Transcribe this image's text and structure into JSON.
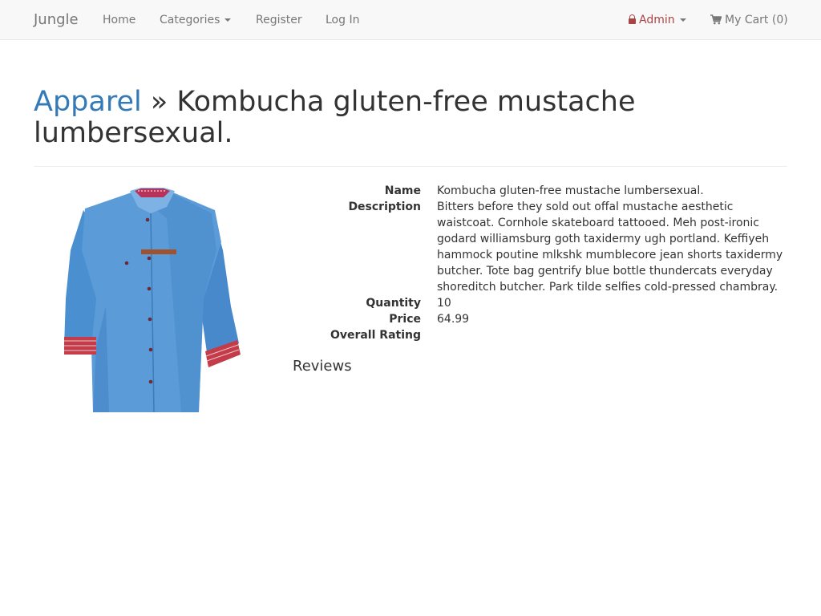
{
  "navbar": {
    "brand": "Jungle",
    "home": "Home",
    "categories": "Categories",
    "register": "Register",
    "login": "Log In",
    "admin": "Admin",
    "cart": "My Cart (0)"
  },
  "header": {
    "category": "Apparel",
    "separator": "»",
    "product_title": "Kombucha gluten-free mustache lumbersexual."
  },
  "product": {
    "image_alt": "blue denim shirt",
    "fields": [
      {
        "label": "Name",
        "value": "Kombucha gluten-free mustache lumbersexual."
      },
      {
        "label": "Description",
        "value": "Bitters before they sold out offal mustache aesthetic waistcoat. Cornhole skateboard tattooed. Meh post-ironic godard williamsburg goth taxidermy ugh portland. Keffiyeh hammock poutine mlkshk mumblecore jean shorts taxidermy butcher. Tote bag gentrify blue bottle thundercats everyday shoreditch butcher. Park tilde selfies cold-pressed chambray."
      },
      {
        "label": "Quantity",
        "value": "10"
      },
      {
        "label": "Price",
        "value": "64.99"
      },
      {
        "label": "Overall Rating",
        "value": ""
      }
    ],
    "reviews_heading": "Reviews"
  },
  "colors": {
    "link": "#337ab7",
    "admin": "#a94442",
    "navbar_bg": "#f8f8f8",
    "shirt": "#4a8fd0"
  }
}
